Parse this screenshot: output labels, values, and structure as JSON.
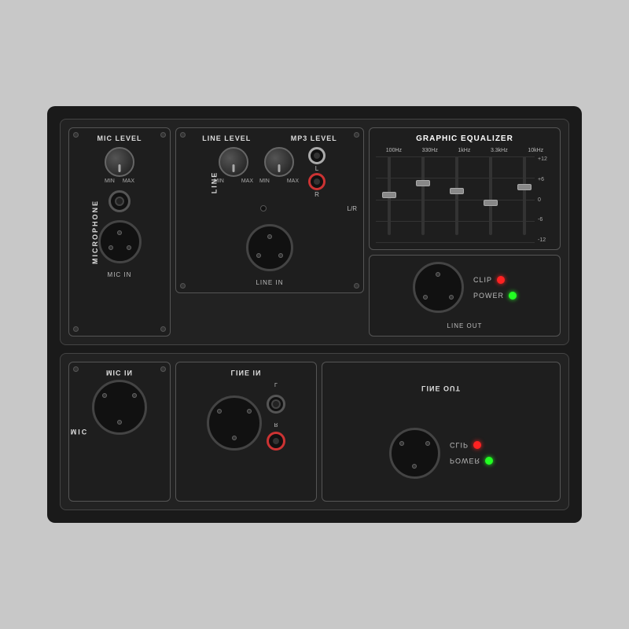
{
  "panels": {
    "mic": {
      "level_label": "MIC LEVEL",
      "vertical_label": "MICROPHONE",
      "knob_min": "MIN",
      "knob_max": "MAX",
      "bottom_label": "MIC IN"
    },
    "line": {
      "level_label": "LINE LEVEL",
      "vertical_label": "LINE",
      "knob_min": "MIN",
      "knob_max": "MAX",
      "lr_label": "L/R",
      "bottom_label": "LINE IN",
      "rca_l": "L",
      "rca_r": "R"
    },
    "mp3": {
      "level_label": "MP3 LEVEL",
      "knob_min": "MIN",
      "knob_max": "MAX"
    },
    "eq": {
      "title": "GRAPHIC EQUALIZER",
      "freqs": [
        "100Hz",
        "330Hz",
        "1kHz",
        "3.3kHz",
        "10kHz"
      ],
      "scale": [
        "+12",
        "+6",
        "0",
        "-6",
        "-12"
      ],
      "slider_positions": [
        50,
        35,
        45,
        60,
        40
      ]
    },
    "line_out": {
      "bottom_label": "LINE OUT",
      "clip_label": "CLIP",
      "power_label": "POWER"
    }
  },
  "bottom": {
    "mic_label": "MIC IN",
    "line_label": "LINE IN",
    "lineout_label": "LINE OUT",
    "power_label": "POWER",
    "clip_label": "CLIP"
  }
}
